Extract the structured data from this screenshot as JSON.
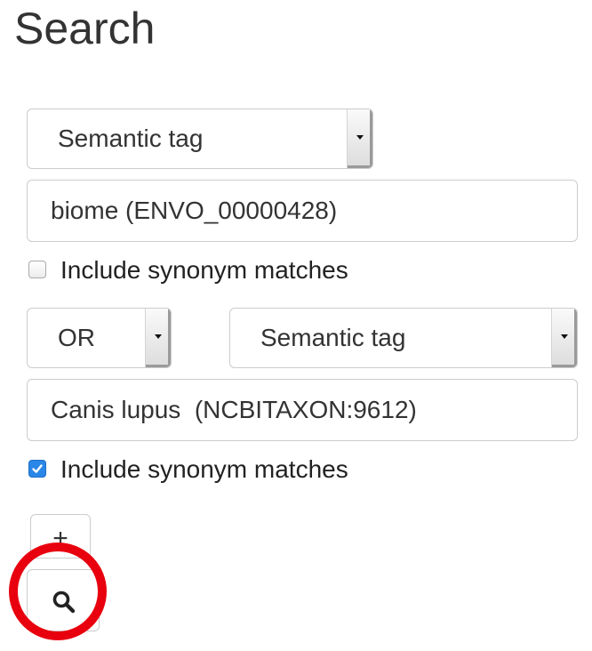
{
  "page": {
    "title": "Search"
  },
  "query_rows": [
    {
      "type_select": {
        "selected": "Semantic tag"
      },
      "value_input": {
        "value": "biome (ENVO_00000428)"
      },
      "synonym": {
        "label": "Include synonym matches",
        "checked": false
      }
    },
    {
      "operator_select": {
        "selected": "OR"
      },
      "type_select": {
        "selected": "Semantic tag"
      },
      "value_input": {
        "value": "Canis lupus  (NCBITAXON:9612)"
      },
      "synonym": {
        "label": "Include synonym matches",
        "checked": true
      }
    }
  ],
  "actions": {
    "add_label": "+",
    "search_icon": "magnifier-icon"
  },
  "annotation": {
    "highlight": "red-circle",
    "color": "#e8000e"
  },
  "colors": {
    "checkbox_checked": "#2a87e8",
    "border": "#cccccc",
    "text": "#333333"
  }
}
